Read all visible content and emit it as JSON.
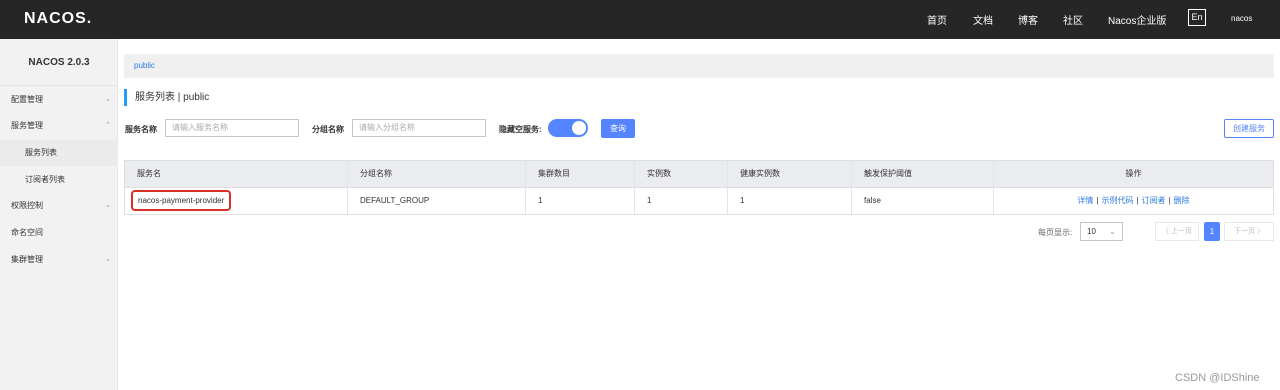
{
  "header": {
    "logo": "NACOS.",
    "nav": [
      "首页",
      "文档",
      "博客",
      "社区",
      "Nacos企业版"
    ],
    "lang": "En",
    "user": "nacos"
  },
  "sidebar": {
    "title": "NACOS 2.0.3",
    "items": [
      {
        "label": "配置管理",
        "chevron": "⌄"
      },
      {
        "label": "服务管理",
        "chevron": "⌃"
      },
      {
        "label": "服务列表"
      },
      {
        "label": "订阅者列表"
      },
      {
        "label": "权限控制",
        "chevron": "⌄"
      },
      {
        "label": "命名空间"
      },
      {
        "label": "集群管理",
        "chevron": "⌄"
      }
    ]
  },
  "breadcrumb": {
    "namespace": "public"
  },
  "page": {
    "title": "服务列表 | public"
  },
  "filters": {
    "service_label": "服务名称",
    "service_placeholder": "请输入服务名称",
    "group_label": "分组名称",
    "group_placeholder": "请输入分组名称",
    "hide_empty_label": "隐藏空服务:",
    "hide_empty_on": true,
    "query_button": "查询",
    "create_button": "创建服务"
  },
  "table": {
    "headers": [
      "服务名",
      "分组名称",
      "集群数目",
      "实例数",
      "健康实例数",
      "触发保护阈值",
      "操作"
    ],
    "rows": [
      {
        "service": "nacos-payment-provider",
        "group": "DEFAULT_GROUP",
        "clusters": "1",
        "instances": "1",
        "healthy": "1",
        "threshold": "false",
        "ops": [
          "详情",
          "示例代码",
          "订阅者",
          "删除"
        ]
      }
    ]
  },
  "pagination": {
    "per_page_label": "每页显示:",
    "per_page_value": "10",
    "prev": "〈 上一页",
    "current": "1",
    "next": "下一页 〉"
  },
  "watermark": "CSDN @IDShine",
  "colors": {
    "accent": "#5584ff",
    "highlight": "#d93026",
    "topbar": "#262626"
  }
}
